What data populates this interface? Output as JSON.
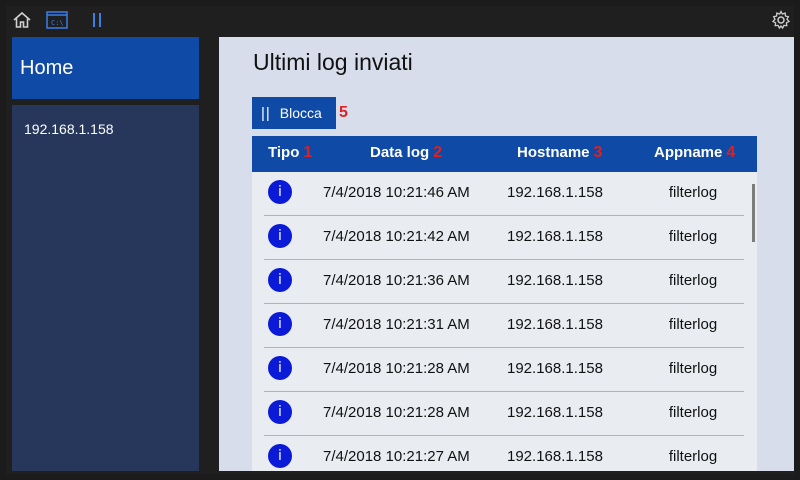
{
  "topbar": {
    "icons": [
      "home-icon",
      "console-icon",
      "pause-icon",
      "gear-icon"
    ]
  },
  "sidebar": {
    "home_label": "Home",
    "items": [
      {
        "label": "192.168.1.158"
      }
    ]
  },
  "main": {
    "title": "Ultimi log inviati",
    "pause_button": {
      "label": "Blocca",
      "marker": "5"
    },
    "table": {
      "columns": [
        {
          "label": "Tipo",
          "marker": "1"
        },
        {
          "label": "Data log",
          "marker": "2"
        },
        {
          "label": "Hostname",
          "marker": "3"
        },
        {
          "label": "Appname",
          "marker": "4"
        }
      ],
      "rows": [
        {
          "icon": "i",
          "date": "7/4/2018 10:21:46 AM",
          "host": "192.168.1.158",
          "app": "filterlog"
        },
        {
          "icon": "i",
          "date": "7/4/2018 10:21:42 AM",
          "host": "192.168.1.158",
          "app": "filterlog"
        },
        {
          "icon": "i",
          "date": "7/4/2018 10:21:36 AM",
          "host": "192.168.1.158",
          "app": "filterlog"
        },
        {
          "icon": "i",
          "date": "7/4/2018 10:21:31 AM",
          "host": "192.168.1.158",
          "app": "filterlog"
        },
        {
          "icon": "i",
          "date": "7/4/2018 10:21:28 AM",
          "host": "192.168.1.158",
          "app": "filterlog"
        },
        {
          "icon": "i",
          "date": "7/4/2018 10:21:28 AM",
          "host": "192.168.1.158",
          "app": "filterlog"
        },
        {
          "icon": "i",
          "date": "7/4/2018 10:21:27 AM",
          "host": "192.168.1.158",
          "app": "filterlog"
        }
      ]
    }
  },
  "colors": {
    "accent": "#0f4aa6",
    "sidebar_panel": "#26375b",
    "main_bg": "#d8ddec",
    "marker_red": "#e02020",
    "info_icon": "#0b1ad6"
  }
}
